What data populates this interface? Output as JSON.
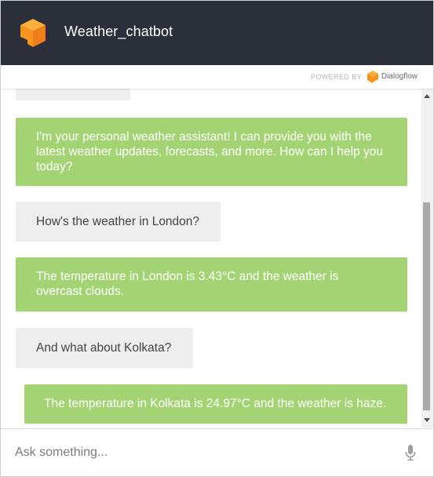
{
  "header": {
    "title": "Weather_chatbot",
    "logo_icon": "dialogflow-agent-logo-icon",
    "background": "#2b2f3a",
    "logo_color": "#f7941d"
  },
  "powered": {
    "label": "POWERED BY",
    "brand": "Dialogflow",
    "brand_icon": "dialogflow-icon"
  },
  "messages": [
    {
      "sender": "bot",
      "text": "I'm your personal weather assistant! I can provide you with the latest weather updates, forecasts, and more. How can I help you today?"
    },
    {
      "sender": "user",
      "text": "How's the weather in London?"
    },
    {
      "sender": "bot",
      "text": "The temperature in London is 3.43°C and the weather is overcast clouds."
    },
    {
      "sender": "user",
      "text": "And what about Kolkata?"
    },
    {
      "sender": "bot",
      "text": "The temperature in Kolkata is 24.97°C and the weather is haze."
    }
  ],
  "input": {
    "placeholder": "Ask something...",
    "value": "",
    "mic_icon": "microphone-icon"
  },
  "colors": {
    "bot_bubble": "#a4d374",
    "user_bubble": "#eeeeee",
    "accent_orange": "#f7941d"
  }
}
